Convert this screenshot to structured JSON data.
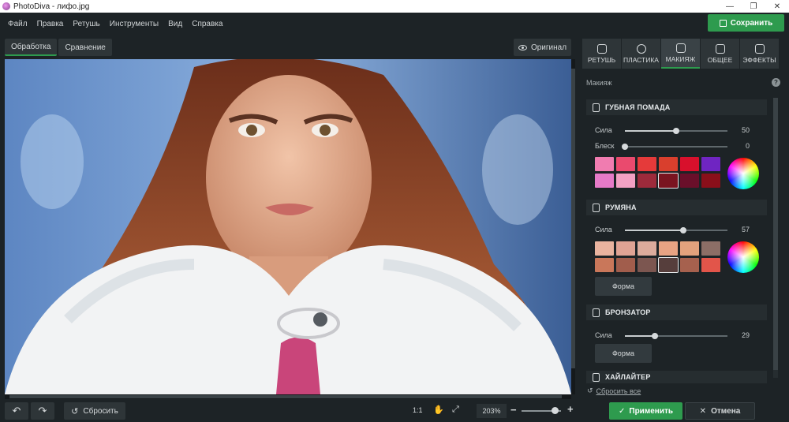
{
  "window": {
    "title": "PhotoDiva - лифо.jpg"
  },
  "menu": [
    "Файл",
    "Правка",
    "Ретушь",
    "Инструменты",
    "Вид",
    "Справка"
  ],
  "toolbar": {
    "save_label": "Сохранить"
  },
  "view_tabs": [
    {
      "label": "Обработка",
      "active": true
    },
    {
      "label": "Сравнение",
      "active": false
    }
  ],
  "original_button": "Оригинал",
  "bottom": {
    "reset_label": "Сбросить",
    "ratio_label": "1:1",
    "zoom_value": "203%"
  },
  "right_tabs": [
    {
      "label": "РЕТУШЬ",
      "icon": "retouch-icon"
    },
    {
      "label": "ПЛАСТИКА",
      "icon": "plastic-icon"
    },
    {
      "label": "МАКИЯЖ",
      "icon": "makeup-icon",
      "active": true
    },
    {
      "label": "ОБЩЕЕ",
      "icon": "general-icon"
    },
    {
      "label": "ЭФФЕКТЫ",
      "icon": "effects-icon"
    }
  ],
  "panel": {
    "title": "Макияж",
    "lipstick": {
      "title": "ГУБНАЯ ПОМАДА",
      "strength_label": "Сила",
      "strength_value": "50",
      "gloss_label": "Блеск",
      "gloss_value": "0",
      "colors": [
        "#f07cb0",
        "#ea4a6e",
        "#e53a3a",
        "#d93f2d",
        "#d8102c",
        "#6f25c2",
        "#e67ac8",
        "#f3a1c4",
        "#9d2a3b",
        "#7a1420",
        "#6a0f2a",
        "#8a0f1a"
      ],
      "selected": 9
    },
    "blush": {
      "title": "РУМЯНА",
      "strength_label": "Сила",
      "strength_value": "57",
      "colors": [
        "#e9b39f",
        "#e0a394",
        "#dcab9c",
        "#e8a383",
        "#e2a27d",
        "#8c6e66",
        "#c9775a",
        "#a15d4c",
        "#7c5650",
        "#563e3c",
        "#a6614e",
        "#e2554a"
      ],
      "selected": 9,
      "shape_label": "Форма"
    },
    "bronzer": {
      "title": "БРОНЗАТОР",
      "strength_label": "Сила",
      "strength_value": "29",
      "shape_label": "Форма"
    },
    "highlighter": {
      "title": "ХАЙЛАЙТЕР"
    },
    "reset_all": "Сбросить все",
    "apply_label": "Применить",
    "cancel_label": "Отмена"
  },
  "sliders": {
    "lipstick_strength": 0.5,
    "lipstick_gloss": 0.0,
    "blush_strength": 0.57,
    "bronzer_strength": 0.29,
    "zoom": 0.8
  }
}
